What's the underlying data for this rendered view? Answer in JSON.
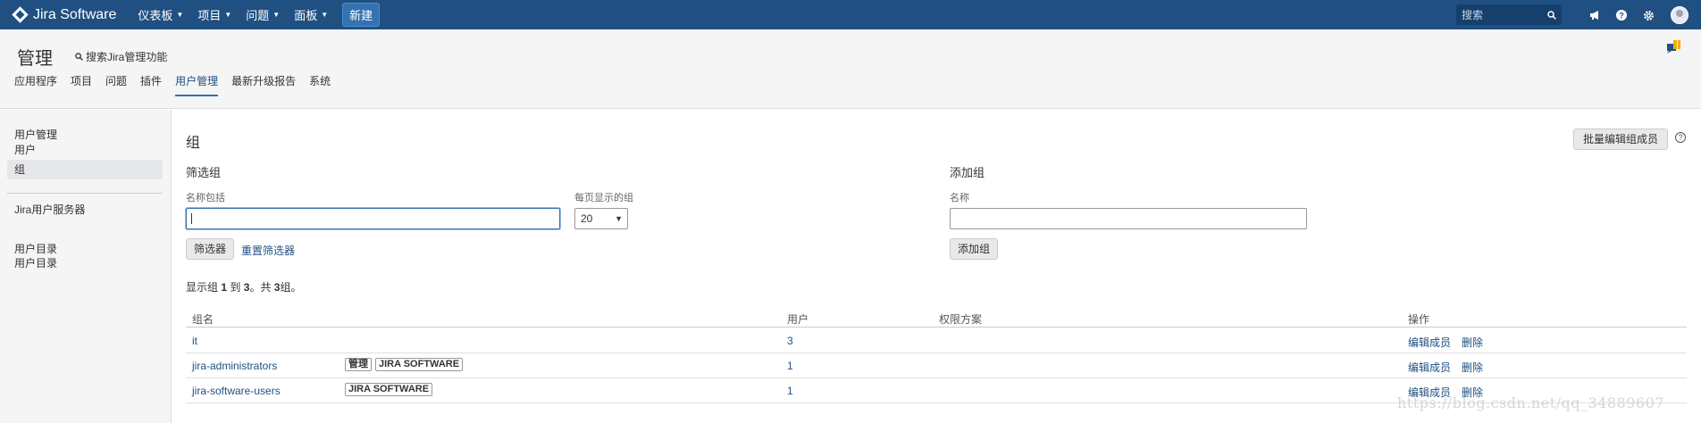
{
  "topbar": {
    "product": "Jira Software",
    "nav": [
      "仪表板",
      "项目",
      "问题",
      "面板"
    ],
    "create": "新建",
    "search_placeholder": "搜索"
  },
  "admin": {
    "title": "管理",
    "search": "搜索Jira管理功能",
    "tabs": [
      "应用程序",
      "项目",
      "问题",
      "插件",
      "用户管理",
      "最新升级报告",
      "系统"
    ],
    "active_tab": "用户管理"
  },
  "sidebar": {
    "section1_title": "用户管理",
    "section1_items": [
      "用户",
      "组"
    ],
    "selected": "组",
    "section2_title": "Jira用户服务器",
    "section3_title": "用户目录",
    "section3_items": [
      "用户目录"
    ]
  },
  "main": {
    "title": "组",
    "bulk_edit": "批量编辑组成员",
    "filter": {
      "heading": "筛选组",
      "name_label": "名称包括",
      "name_value": "",
      "per_page_label": "每页显示的组",
      "per_page_value": "20",
      "filter_button": "筛选器",
      "reset_link": "重置筛选器"
    },
    "add": {
      "heading": "添加组",
      "name_label": "名称",
      "name_value": "",
      "add_button": "添加组"
    },
    "count_prefix": "显示组",
    "count_from": "1",
    "count_to_word": "到",
    "count_to": "3",
    "count_total_word": "。共",
    "count_total": "3",
    "count_suffix": "组。",
    "columns": [
      "组名",
      "用户",
      "权限方案",
      "操作"
    ],
    "rows": [
      {
        "name": "it",
        "badges": [],
        "users": "3",
        "ops": [
          "编辑成员",
          "删除"
        ]
      },
      {
        "name": "jira-administrators",
        "badges": [
          "管理",
          "JIRA SOFTWARE"
        ],
        "users": "1",
        "ops": [
          "编辑成员",
          "删除"
        ]
      },
      {
        "name": "jira-software-users",
        "badges": [
          "JIRA SOFTWARE"
        ],
        "users": "1",
        "ops": [
          "编辑成员",
          "删除"
        ]
      }
    ]
  },
  "watermark": "https://blog.csdn.net/qq_34889607",
  "colors": {
    "topbar": "#205081",
    "link": "#205081",
    "create": "#3572b0"
  }
}
